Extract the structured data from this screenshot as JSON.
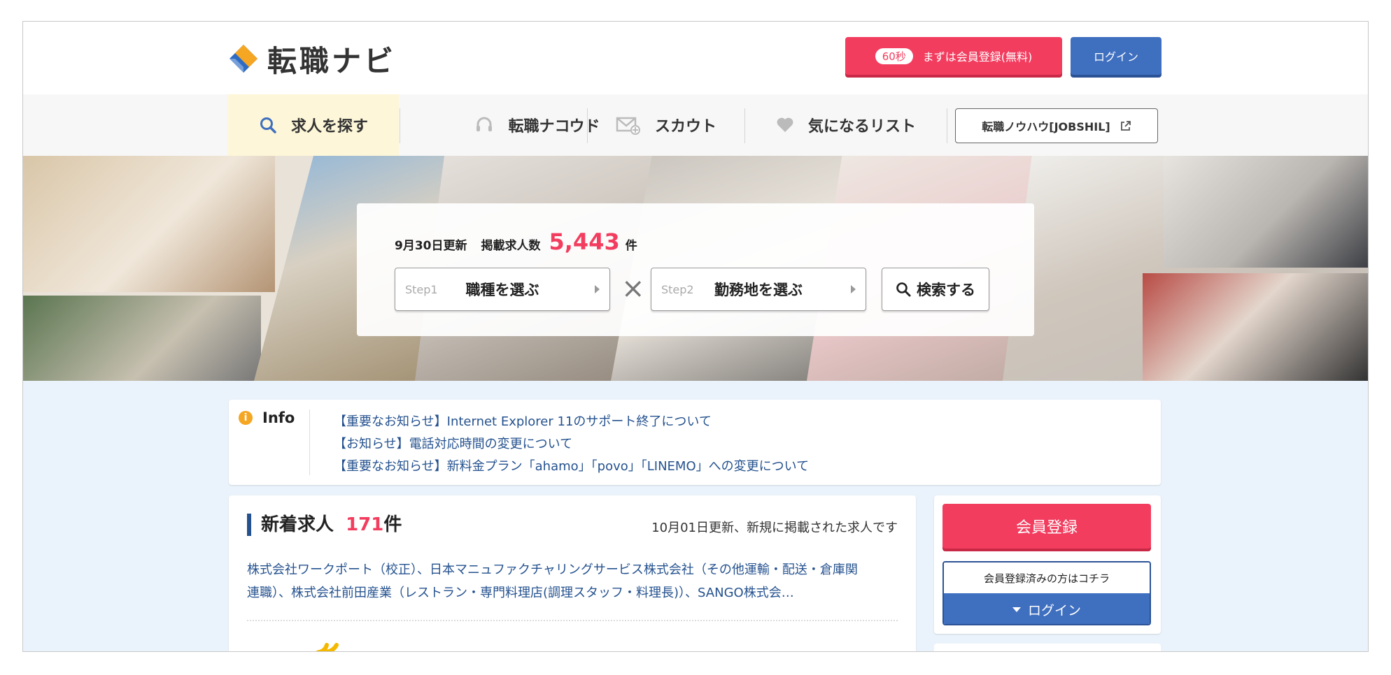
{
  "header": {
    "logo_text": "転職ナビ",
    "register_badge": "60秒",
    "register_label": "まずは会員登録(無料)",
    "login_label": "ログイン"
  },
  "nav": {
    "items": [
      {
        "label": "求人を探す",
        "icon": "search-icon"
      },
      {
        "label": "転職ナコウド",
        "icon": "headset-icon"
      },
      {
        "label": "スカウト",
        "icon": "mail-plus-icon"
      },
      {
        "label": "気になるリスト",
        "icon": "heart-icon"
      }
    ],
    "external_label": "転職ノウハウ[JOBSHIL]",
    "external_icon": "external-link-icon"
  },
  "search": {
    "updated": "9月30日更新",
    "listed_label": "掲載求人数",
    "count": "5,443",
    "count_unit": "件",
    "step1_label": "Step1",
    "step1_title": "職種を選ぶ",
    "times": "×",
    "step2_label": "Step2",
    "step2_title": "勤務地を選ぶ",
    "search_button": "検索する"
  },
  "info": {
    "heading": "Info",
    "links": [
      "【重要なお知らせ】Internet Explorer 11のサポート終了について",
      "【お知らせ】電話対応時間の変更について",
      "【重要なお知らせ】新料金プラン「ahamo」「povo」「LINEMO」への変更について"
    ]
  },
  "new_jobs": {
    "title_prefix": "新着求人",
    "count": "171",
    "count_unit": "件",
    "meta": "10月01日更新、新規に掲載された求人です",
    "companies_line1": "株式会社ワークポート（校正）、日本マニュファクチャリングサービス株式会社（その他運輸・配送・倉庫関",
    "companies_line2": "連職）、株式会社前田産業（レストラン・専門料理店(調理スタッフ・料理長)）、SANGO株式会…"
  },
  "sidebar": {
    "register_label": "会員登録",
    "login_note": "会員登録済みの方はコチラ",
    "login_label": "ログイン"
  },
  "colors": {
    "accent_red": "#f23d5f",
    "accent_blue": "#3f6fbf",
    "link_blue": "#25528f"
  }
}
